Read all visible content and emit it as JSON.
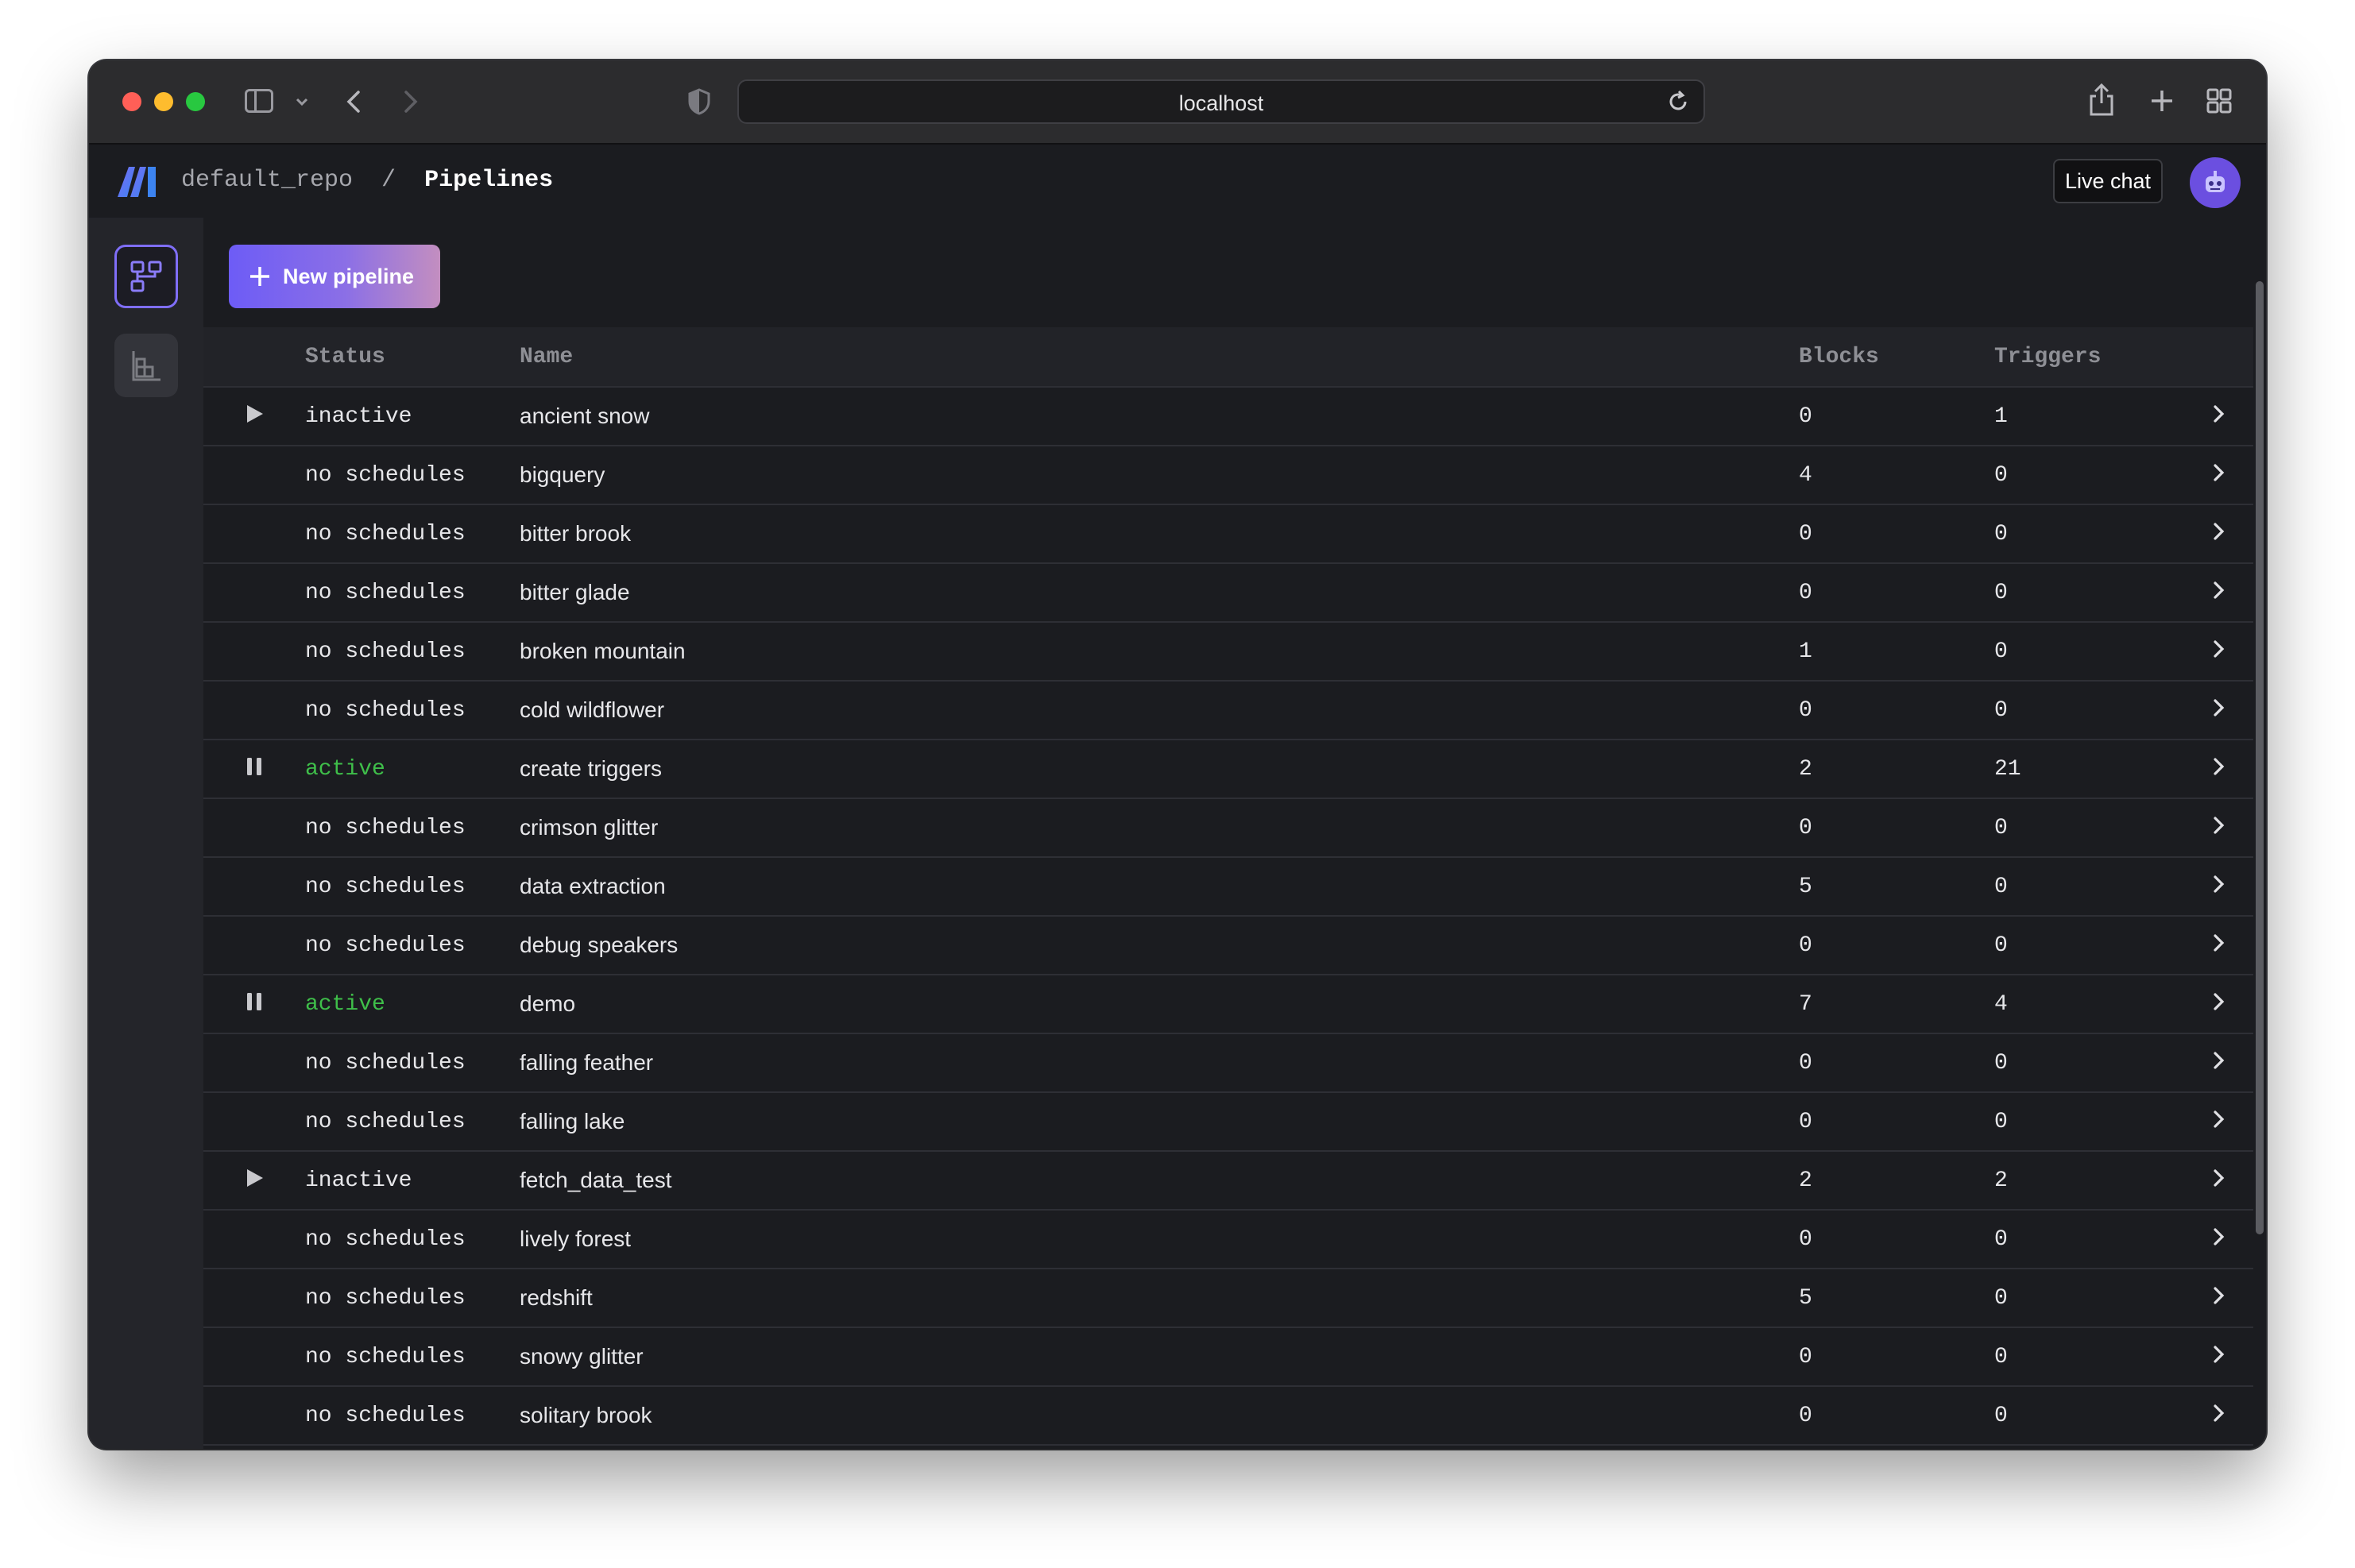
{
  "browser": {
    "url": "localhost"
  },
  "header": {
    "repo": "default_repo",
    "separator": "/",
    "page": "Pipelines",
    "live_chat_label": "Live chat"
  },
  "toolbar": {
    "new_pipeline_label": "New pipeline"
  },
  "table": {
    "columns": [
      "Status",
      "Name",
      "Blocks",
      "Triggers"
    ],
    "rows": [
      {
        "control": "play",
        "status": "inactive",
        "name": "ancient snow",
        "blocks": "0",
        "triggers": "1"
      },
      {
        "control": "",
        "status": "no schedules",
        "name": "bigquery",
        "blocks": "4",
        "triggers": "0"
      },
      {
        "control": "",
        "status": "no schedules",
        "name": "bitter brook",
        "blocks": "0",
        "triggers": "0"
      },
      {
        "control": "",
        "status": "no schedules",
        "name": "bitter glade",
        "blocks": "0",
        "triggers": "0"
      },
      {
        "control": "",
        "status": "no schedules",
        "name": "broken mountain",
        "blocks": "1",
        "triggers": "0"
      },
      {
        "control": "",
        "status": "no schedules",
        "name": "cold wildflower",
        "blocks": "0",
        "triggers": "0"
      },
      {
        "control": "pause",
        "status": "active",
        "name": "create triggers",
        "blocks": "2",
        "triggers": "21"
      },
      {
        "control": "",
        "status": "no schedules",
        "name": "crimson glitter",
        "blocks": "0",
        "triggers": "0"
      },
      {
        "control": "",
        "status": "no schedules",
        "name": "data extraction",
        "blocks": "5",
        "triggers": "0"
      },
      {
        "control": "",
        "status": "no schedules",
        "name": "debug speakers",
        "blocks": "0",
        "triggers": "0"
      },
      {
        "control": "pause",
        "status": "active",
        "name": "demo",
        "blocks": "7",
        "triggers": "4"
      },
      {
        "control": "",
        "status": "no schedules",
        "name": "falling feather",
        "blocks": "0",
        "triggers": "0"
      },
      {
        "control": "",
        "status": "no schedules",
        "name": "falling lake",
        "blocks": "0",
        "triggers": "0"
      },
      {
        "control": "play",
        "status": "inactive",
        "name": "fetch_data_test",
        "blocks": "2",
        "triggers": "2"
      },
      {
        "control": "",
        "status": "no schedules",
        "name": "lively forest",
        "blocks": "0",
        "triggers": "0"
      },
      {
        "control": "",
        "status": "no schedules",
        "name": "redshift",
        "blocks": "5",
        "triggers": "0"
      },
      {
        "control": "",
        "status": "no schedules",
        "name": "snowy glitter",
        "blocks": "0",
        "triggers": "0"
      },
      {
        "control": "",
        "status": "no schedules",
        "name": "solitary brook",
        "blocks": "0",
        "triggers": "0"
      }
    ]
  },
  "colors": {
    "accent": "#7f6ef7",
    "active_status": "#3fbf4a",
    "background": "#1b1c20"
  }
}
